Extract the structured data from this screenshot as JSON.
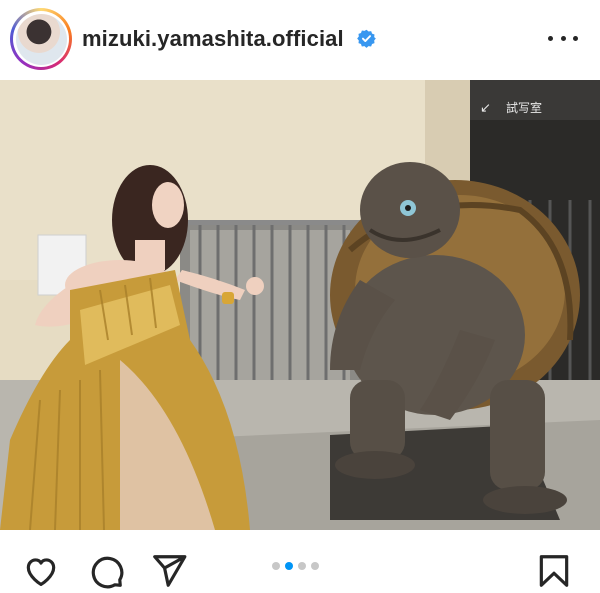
{
  "post": {
    "username": "mizuki.yamashita.official",
    "verified": true,
    "verified_color": "#3897f0",
    "more_icon": "more-horizontal-icon"
  },
  "photo": {
    "sign_text": "試写室",
    "sign_arrow": "↙"
  },
  "carousel": {
    "total": 4,
    "active_index": 1,
    "active_color": "#0095f6",
    "inactive_color": "#c7c7c7"
  },
  "actions": {
    "like_icon": "heart-icon",
    "comment_icon": "comment-icon",
    "share_icon": "send-icon",
    "save_icon": "bookmark-icon"
  }
}
